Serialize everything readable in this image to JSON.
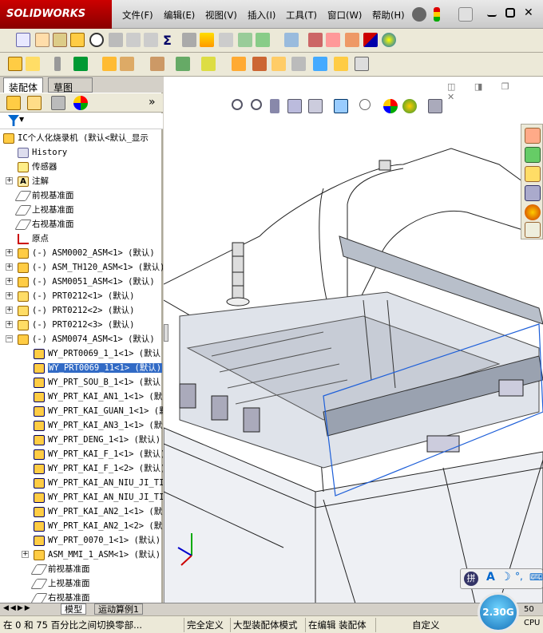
{
  "app": {
    "brand": "SOLIDWORKS"
  },
  "menu": [
    {
      "label": "文件(F)"
    },
    {
      "label": "编辑(E)"
    },
    {
      "label": "视图(V)"
    },
    {
      "label": "插入(I)"
    },
    {
      "label": "工具(T)"
    },
    {
      "label": "窗口(W)"
    },
    {
      "label": "帮助(H)"
    }
  ],
  "panel_tabs": {
    "assembly": "装配体",
    "sketch": "草图"
  },
  "tree": {
    "root": "IC个人化烧录机  (默认<默认_显示",
    "items": [
      {
        "label": "History"
      },
      {
        "label": "传感器"
      },
      {
        "label": "注解"
      },
      {
        "label": "前视基准面"
      },
      {
        "label": "上视基准面"
      },
      {
        "label": "右视基准面"
      },
      {
        "label": "原点"
      },
      {
        "label": "(-) ASM0002_ASM<1> (默认)"
      },
      {
        "label": "(-) ASM_TH120_ASM<1> (默认)"
      },
      {
        "label": "(-) ASM0051_ASM<1> (默认)"
      },
      {
        "label": "(-) PRT0212<1> (默认)"
      },
      {
        "label": "(-) PRT0212<2> (默认)"
      },
      {
        "label": "(-) PRT0212<3> (默认)"
      },
      {
        "label": "(-) ASM0074_ASM<1> (默认)"
      },
      {
        "label": "WY_PRT0069_1_1<1> (默认"
      },
      {
        "label": "WY_PRT0069_11<1> (默认)"
      },
      {
        "label": "WY_PRT_SOU_B_1<1> (默认"
      },
      {
        "label": "WY_PRT_KAI_AN1_1<1> (默"
      },
      {
        "label": "WY_PRT_KAI_GUAN_1<1> (默"
      },
      {
        "label": "WY_PRT_KAI_AN3_1<1> (默认"
      },
      {
        "label": "WY_PRT_DENG_1<1> (默认)"
      },
      {
        "label": "WY_PRT_KAI_F_1<1> (默认)"
      },
      {
        "label": "WY_PRT_KAI_F_1<2> (默认)"
      },
      {
        "label": "WY_PRT_KAI_AN_NIU_JI_TI"
      },
      {
        "label": "WY_PRT_KAI_AN_NIU_JI_TI"
      },
      {
        "label": "WY_PRT_KAI_AN2_1<1> (默"
      },
      {
        "label": "WY_PRT_KAI_AN2_1<2> (默"
      },
      {
        "label": "WY_PRT_0070_1<1> (默认)"
      },
      {
        "label": "ASM_MMI_1_ASM<1> (默认)"
      },
      {
        "label": "前视基准面"
      },
      {
        "label": "上视基准面"
      },
      {
        "label": "右视基准面"
      }
    ]
  },
  "bottom_tabs": {
    "model": "模型",
    "motion": "运动算例1"
  },
  "status": {
    "hint": "在 0 和 75 百分比之间切换零部...",
    "defined": "完全定义",
    "mode": "大型装配体模式",
    "editing": "在编辑 装配体",
    "custom": "自定义"
  },
  "gauge": {
    "value": "2.30G"
  },
  "cpu_label": "CPU",
  "cpu_value": "50"
}
